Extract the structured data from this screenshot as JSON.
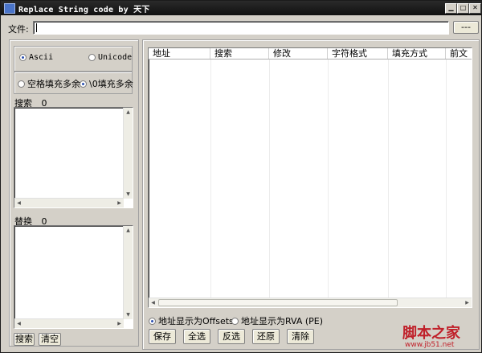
{
  "window": {
    "title": "Replace String code by 天下",
    "min_icon": "minimize-icon",
    "max_icon": "maximize-icon",
    "close_icon": "close-icon"
  },
  "file": {
    "label": "文件:",
    "value": "",
    "browse_label": "---"
  },
  "encoding": {
    "ascii_label": "Ascii",
    "unicode_label": "Unicode",
    "selected": "Ascii"
  },
  "fill": {
    "space_label": "空格填充多余",
    "null_label": "\\0填充多余",
    "selected": "\\0填充多余"
  },
  "search_box": {
    "label": "搜索",
    "count": "0"
  },
  "replace_box": {
    "label": "替换",
    "count": "0"
  },
  "left_buttons": {
    "search": "搜索",
    "clear": "清空"
  },
  "table": {
    "columns": [
      "地址",
      "搜索",
      "修改",
      "字符格式",
      "填充方式",
      "前文"
    ]
  },
  "address_mode": {
    "offsets_label": "地址显示为Offsets",
    "rva_label": "地址显示为RVA (PE)",
    "selected": "Offsets"
  },
  "bottom_buttons": {
    "save": "保存",
    "select_all": "全选",
    "invert": "反选",
    "restore": "还原",
    "clear": "清除"
  },
  "watermark": {
    "brand": "脚本之家",
    "url": "www.jb51.net"
  },
  "colors": {
    "titlebar": "#1a1a1a",
    "window_bg": "#d4d0c8",
    "radio_dot": "#2b4fb0",
    "watermark": "#c0202a"
  }
}
